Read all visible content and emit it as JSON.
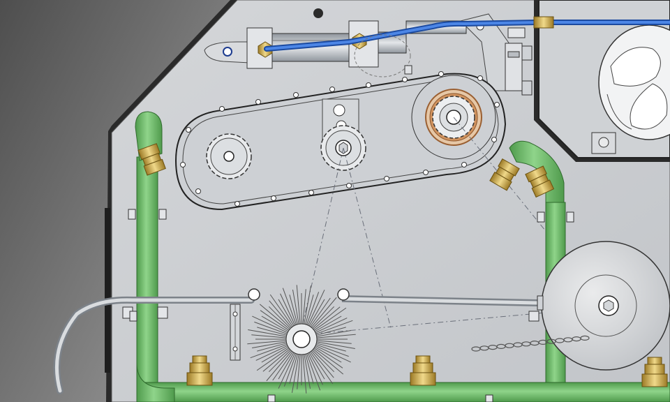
{
  "view": {
    "background_gradient": [
      "#5a5a5a",
      "#ffffff"
    ],
    "plate_color": "#c9ccd0",
    "hose_color": "#6fb86a",
    "tube_color": "#2f6fd6",
    "fitting_color": "#c8a64a",
    "bushing_color": "#c98a5a"
  },
  "parts": {
    "hydraulic_cylinder": "hydraulic-cylinder",
    "hydraulic_line": "hydraulic-line",
    "drive_chain_housing": "chain-guard",
    "sprocket_left": "sprocket-left",
    "sprocket_idler": "sprocket-idler",
    "sprocket_drive": "sprocket-drive",
    "brush": "rotary-brush",
    "disc": "disc-wheel",
    "fan": "cooling-fan",
    "roller_chain": "roller-chain",
    "spray_bar": "spray-bar"
  }
}
